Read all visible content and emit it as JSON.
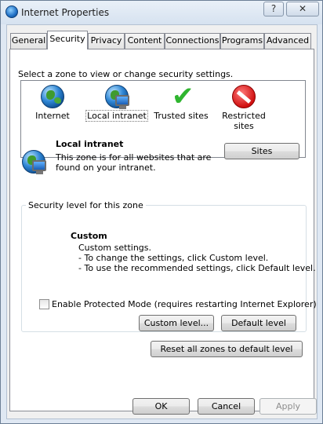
{
  "window": {
    "title": "Internet Properties",
    "help_label": "?",
    "close_label": "✕"
  },
  "tabs": [
    {
      "label": "General",
      "active": false
    },
    {
      "label": "Security",
      "active": true
    },
    {
      "label": "Privacy",
      "active": false
    },
    {
      "label": "Content",
      "active": false
    },
    {
      "label": "Connections",
      "active": false
    },
    {
      "label": "Programs",
      "active": false
    },
    {
      "label": "Advanced",
      "active": false
    }
  ],
  "security": {
    "zone_prompt": "Select a zone to view or change security settings.",
    "zones": [
      {
        "label": "Internet",
        "icon": "globe-icon"
      },
      {
        "label": "Local intranet",
        "icon": "intranet-icon",
        "selected": true
      },
      {
        "label": "Trusted sites",
        "icon": "checkmark-icon"
      },
      {
        "label": "Restricted sites",
        "icon": "no-entry-icon"
      }
    ],
    "selected_zone": {
      "title": "Local intranet",
      "description": "This zone is for all websites that are found on your intranet.",
      "icon": "intranet-icon"
    },
    "sites_button": "Sites",
    "level_group_label": "Security level for this zone",
    "level_name": "Custom",
    "level_lines": [
      "Custom settings.",
      "- To change the settings, click Custom level.",
      "- To use the recommended settings, click Default level."
    ],
    "protected_mode_label": "Enable Protected Mode (requires restarting Internet Explorer)",
    "protected_mode_checked": false,
    "custom_level_button": "Custom level...",
    "default_level_button": "Default level",
    "reset_all_button": "Reset all zones to default level"
  },
  "footer": {
    "ok": "OK",
    "cancel": "Cancel",
    "apply": "Apply"
  },
  "colors": {
    "window_frame": "#dfe8f3",
    "panel_bg": "#ffffff",
    "dialog_bg": "#f0f0f0"
  }
}
